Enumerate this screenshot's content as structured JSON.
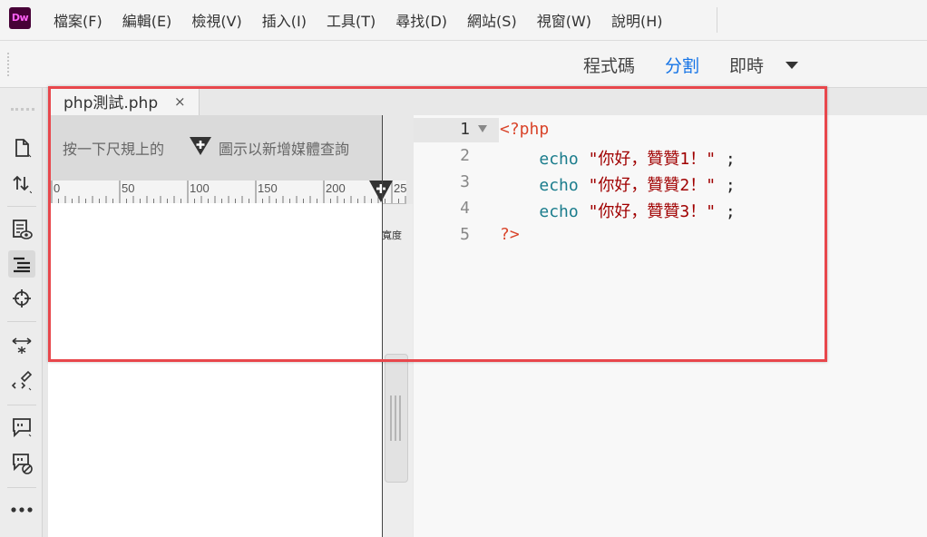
{
  "app": {
    "logo_text": "Dw",
    "brand_color": "#470137",
    "accent_color": "#1473e6"
  },
  "menu": {
    "items": [
      "檔案(F)",
      "編輯(E)",
      "檢視(V)",
      "插入(I)",
      "工具(T)",
      "尋找(D)",
      "網站(S)",
      "視窗(W)",
      "說明(H)"
    ]
  },
  "view_switcher": {
    "code_label": "程式碼",
    "split_label": "分割",
    "live_label": "即時",
    "active": "分割",
    "dropdown_icon": "caret-down-icon"
  },
  "tools": [
    {
      "name": "new-file-icon",
      "active": false
    },
    {
      "name": "sort-icon",
      "active": false
    },
    {
      "name": "preview-eye-icon",
      "active": false
    },
    {
      "name": "code-format-icon",
      "active": true
    },
    {
      "name": "crosshair-icon",
      "active": false
    },
    {
      "name": "expand-arrows-icon",
      "active": false
    },
    {
      "name": "code-brush-icon",
      "active": false
    },
    {
      "name": "comment-icon",
      "active": false
    },
    {
      "name": "remove-comment-icon",
      "active": false
    },
    {
      "name": "more-icon",
      "active": false
    }
  ],
  "document": {
    "tab_title": "php測試.php",
    "close_glyph": "×"
  },
  "design": {
    "mq_hint_pre": "按一下尺規上的",
    "mq_hint_post": "圖示以新增媒體查詢",
    "ruler_ticks": [
      "0",
      "50",
      "100",
      "150",
      "200",
      "25"
    ],
    "width_label": "寬度"
  },
  "code": {
    "active_line": 1,
    "lines": [
      {
        "num": "1",
        "parts": [
          {
            "t": "<?php",
            "c": "tag"
          }
        ]
      },
      {
        "num": "2",
        "parts": [
          {
            "t": "    ",
            "c": "punc"
          },
          {
            "t": "echo",
            "c": "kw"
          },
          {
            "t": " ",
            "c": "punc"
          },
          {
            "t": "\"你好，贊贊1！\"",
            "c": "str"
          },
          {
            "t": " ;",
            "c": "punc"
          }
        ]
      },
      {
        "num": "3",
        "parts": [
          {
            "t": "    ",
            "c": "punc"
          },
          {
            "t": "echo",
            "c": "kw"
          },
          {
            "t": " ",
            "c": "punc"
          },
          {
            "t": "\"你好，贊贊2！\"",
            "c": "str"
          },
          {
            "t": " ;",
            "c": "punc"
          }
        ]
      },
      {
        "num": "4",
        "parts": [
          {
            "t": "    ",
            "c": "punc"
          },
          {
            "t": "echo",
            "c": "kw"
          },
          {
            "t": " ",
            "c": "punc"
          },
          {
            "t": "\"你好，贊贊3！\"",
            "c": "str"
          },
          {
            "t": " ;",
            "c": "punc"
          }
        ]
      },
      {
        "num": "5",
        "parts": [
          {
            "t": "?>",
            "c": "tag"
          }
        ]
      }
    ]
  },
  "highlight": {
    "color": "#e8474c"
  }
}
